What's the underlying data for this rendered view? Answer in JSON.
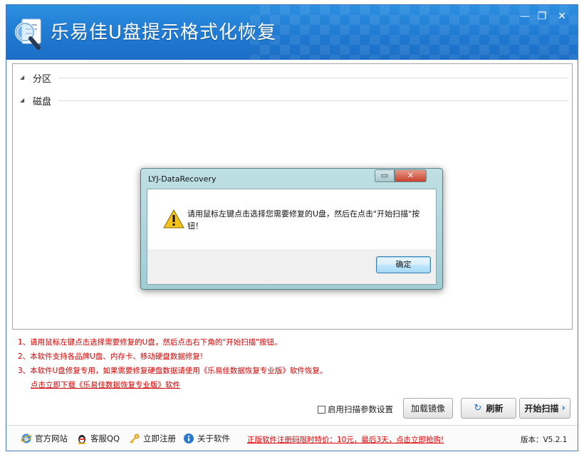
{
  "app": {
    "title": "乐易佳U盘提示格式化恢复",
    "minimize_glyph": "—",
    "restore_glyph": "❐",
    "close_glyph": "✕"
  },
  "tree": {
    "groups": [
      {
        "label": "分区"
      },
      {
        "label": "磁盘"
      }
    ]
  },
  "notes": [
    "1、请用鼠标左键点击选择需要修复的U盘，然后点击右下角的\"开始扫描\"按钮。",
    "2、本软件支持各品牌U盘、内存卡、移动硬盘数据修复!",
    "3、本软件U盘修复专用，如果需要修复硬盘数据请使用《乐易佳数据恢复专业版》软件恢复。"
  ],
  "download_link": "点击立即下载《乐易佳数据恢复专业版》软件",
  "controls": {
    "scan_params_label": "启用扫描参数设置",
    "load_image_label": "加载镜像",
    "refresh_label": "刷新",
    "start_scan_label": "开始扫描"
  },
  "statusbar": {
    "official_site": "官方网站",
    "support_qq": "客服QQ",
    "register": "立即注册",
    "about": "关于软件",
    "promo": "正版软件注册码限时特价：10元，最后3天，点击立即抢购!",
    "version": "版本：V5.2.1"
  },
  "dialog": {
    "title": "LYJ-DataRecovery",
    "message": "请用鼠标左键点击选择您需要修复的U盘，然后在点击\"开始扫描\"按钮！",
    "ok_label": "确定"
  },
  "colors": {
    "title_blue": "#1f78d0",
    "note_red": "#d00000",
    "dialog_frame": "#9fcdd4"
  }
}
